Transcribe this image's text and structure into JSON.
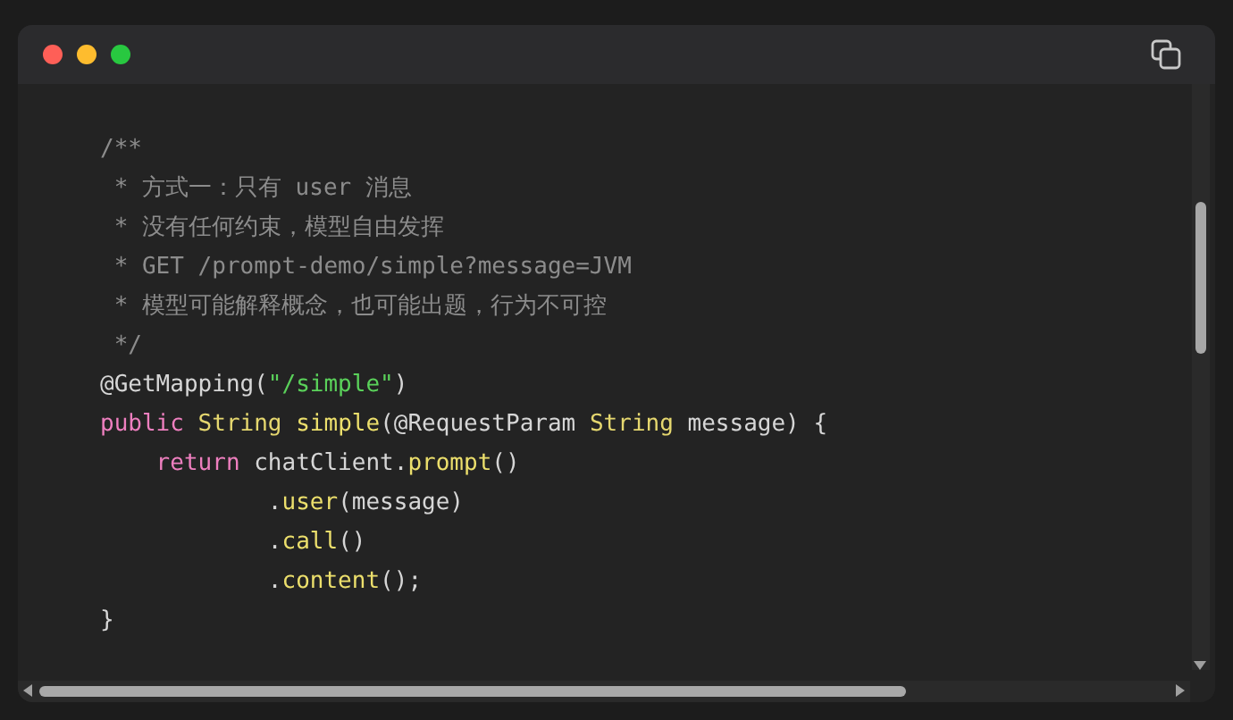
{
  "lines": [
    {
      "tokens": [
        {
          "kind": "comment",
          "text": "/**"
        }
      ]
    },
    {
      "tokens": [
        {
          "kind": "comment",
          "text": " * 方式一：只有 user 消息"
        }
      ]
    },
    {
      "tokens": [
        {
          "kind": "comment",
          "text": " * 没有任何约束，模型自由发挥"
        }
      ]
    },
    {
      "tokens": [
        {
          "kind": "comment",
          "text": " * GET /prompt-demo/simple?message=JVM"
        }
      ]
    },
    {
      "tokens": [
        {
          "kind": "comment",
          "text": " * 模型可能解释概念，也可能出题，行为不可控"
        }
      ]
    },
    {
      "tokens": [
        {
          "kind": "comment",
          "text": " */"
        }
      ]
    },
    {
      "tokens": [
        {
          "kind": "plain",
          "text": "@GetMapping("
        },
        {
          "kind": "string",
          "text": "\"/simple\""
        },
        {
          "kind": "plain",
          "text": ")"
        }
      ]
    },
    {
      "tokens": [
        {
          "kind": "keyword",
          "text": "public "
        },
        {
          "kind": "type",
          "text": "String "
        },
        {
          "kind": "method",
          "text": "simple"
        },
        {
          "kind": "plain",
          "text": "(@RequestParam "
        },
        {
          "kind": "type",
          "text": "String "
        },
        {
          "kind": "plain",
          "text": "message) {"
        }
      ]
    },
    {
      "tokens": [
        {
          "kind": "keyword",
          "text": "    return "
        },
        {
          "kind": "plain",
          "text": "chatClient."
        },
        {
          "kind": "method",
          "text": "prompt"
        },
        {
          "kind": "plain",
          "text": "()"
        }
      ]
    },
    {
      "tokens": [
        {
          "kind": "plain",
          "text": "            ."
        },
        {
          "kind": "method",
          "text": "user"
        },
        {
          "kind": "plain",
          "text": "(message)"
        }
      ]
    },
    {
      "tokens": [
        {
          "kind": "plain",
          "text": "            ."
        },
        {
          "kind": "method",
          "text": "call"
        },
        {
          "kind": "plain",
          "text": "()"
        }
      ]
    },
    {
      "tokens": [
        {
          "kind": "plain",
          "text": "            ."
        },
        {
          "kind": "method",
          "text": "content"
        },
        {
          "kind": "plain",
          "text": "();"
        }
      ]
    },
    {
      "tokens": [
        {
          "kind": "plain",
          "text": "}"
        }
      ]
    }
  ]
}
